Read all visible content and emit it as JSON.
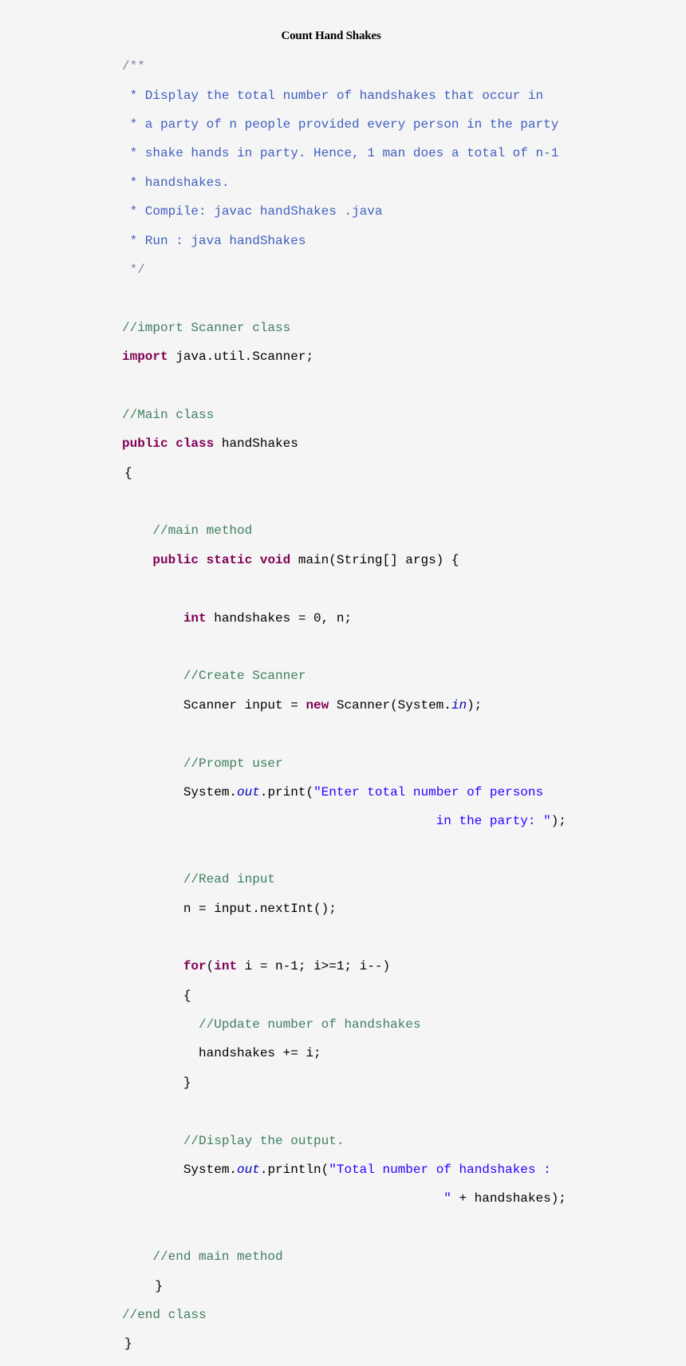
{
  "title": "Count Hand Shakes",
  "code": {
    "language": "java",
    "javadoc": {
      "open": "/**",
      "lines": [
        " * Display the total number of handshakes that occur in",
        " * a party of n people provided every person in the party",
        " * shake hands in party. Hence, 1 man does a total of n-1",
        " * handshakes.",
        " * Compile: javac handShakes .java",
        " * Run : java handShakes"
      ],
      "close": " */"
    },
    "import_comment": "//import Scanner class",
    "import_kw": "import",
    "import_path": " java.util.Scanner;",
    "class_comment": "//Main class",
    "class_kw1": "public",
    "class_kw2": "class",
    "class_name": " handShakes",
    "open_brace": "{",
    "main_comment": "//main method",
    "main_kw1": "public",
    "main_kw2": "static",
    "main_kw3": "void",
    "main_sig": " main(String[] args) {",
    "int_kw": "int",
    "int_decl": " handshakes = 0, n;",
    "scanner_comment": "//Create Scanner",
    "scanner_pre": "Scanner input = ",
    "scanner_new": "new",
    "scanner_post": " Scanner(System.",
    "scanner_in": "in",
    "scanner_end": ");",
    "prompt_comment": "//Prompt user",
    "prompt_pre": "System.",
    "prompt_out": "out",
    "prompt_call": ".print(",
    "prompt_str1": "\"Enter total number of persons",
    "prompt_str2": "in the party: \"",
    "prompt_end": ");",
    "read_comment": "//Read input",
    "read_stmt": "n = input.nextInt();",
    "for_kw": "for",
    "for_paren": "(",
    "for_int": "int",
    "for_rest": " i = n-1; i>=1; i--)",
    "for_open": "{",
    "update_comment": "//Update number of handshakes",
    "update_stmt": "handshakes += i;",
    "for_close": "}",
    "display_comment": "//Display the output.",
    "display_pre": "System.",
    "display_out": "out",
    "display_call": ".println(",
    "display_str1": "\"Total number of handshakes :",
    "display_str2": "\"",
    "display_end": " + handshakes);",
    "end_main_comment": "//end main method",
    "end_main_brace": "}",
    "end_class_comment": "//end class",
    "end_class_brace": "}"
  }
}
